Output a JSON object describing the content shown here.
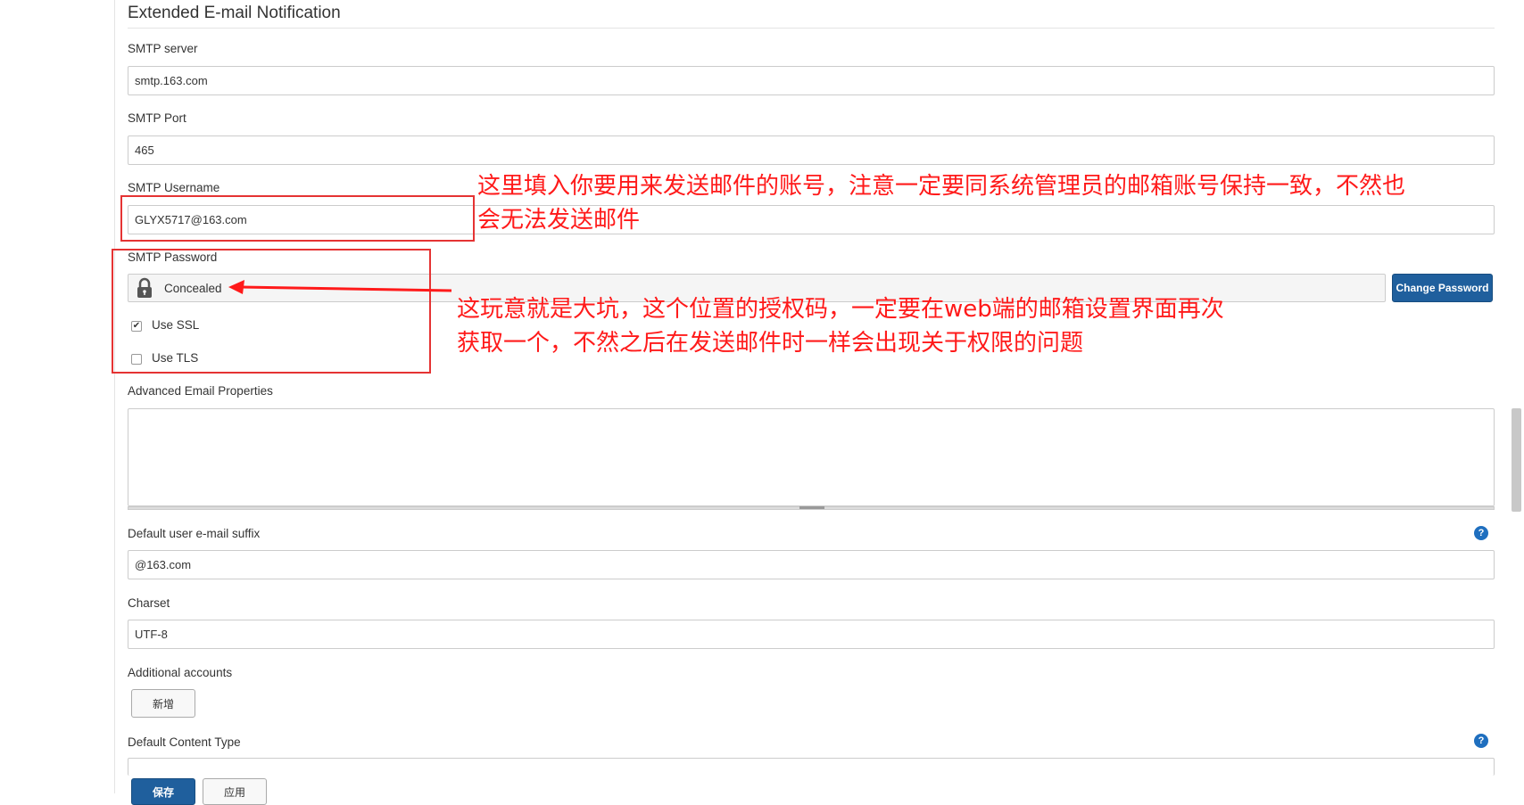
{
  "section": {
    "title": "Extended E-mail Notification"
  },
  "smtp_server": {
    "label": "SMTP server",
    "value": "smtp.163.com"
  },
  "smtp_port": {
    "label": "SMTP Port",
    "value": "465"
  },
  "smtp_username": {
    "label": "SMTP Username",
    "value": "GLYX5717@163.com"
  },
  "smtp_password": {
    "label": "SMTP Password",
    "concealed_text": "Concealed",
    "change_label": "Change Password"
  },
  "use_ssl": {
    "label": "Use SSL",
    "checked": true
  },
  "use_tls": {
    "label": "Use TLS",
    "checked": false
  },
  "advanced_props": {
    "label": "Advanced Email Properties",
    "value": ""
  },
  "email_suffix": {
    "label": "Default user e-mail suffix",
    "value": "@163.com",
    "help": "?"
  },
  "charset": {
    "label": "Charset",
    "value": "UTF-8"
  },
  "additional_accounts": {
    "label": "Additional accounts",
    "add_label": "新增"
  },
  "content_type": {
    "label": "Default Content Type",
    "help": "?"
  },
  "actions": {
    "save_label": "保存",
    "apply_label": "应用"
  },
  "annotations": {
    "username_line1": "这里填入你要用来发送邮件的账号，注意一定要同系统管理员的邮箱账号保持一致，不然也",
    "username_line2": "会无法发送邮件",
    "password_line1": "这玩意就是大坑，这个位置的授权码，一定要在web端的邮箱设置界面再次",
    "password_line2": "获取一个，不然之后在发送邮件时一样会出现关于权限的问题"
  },
  "colors": {
    "annotation": "#ff1a1a",
    "primary_button": "#1f5f9d",
    "help_icon": "#1f6fbf"
  }
}
